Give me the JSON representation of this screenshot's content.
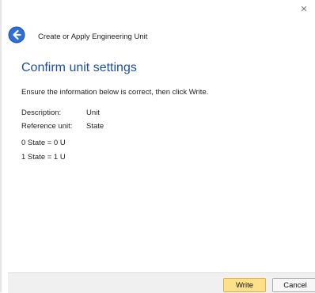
{
  "window": {
    "close_glyph": "×"
  },
  "header": {
    "wizard_title": "Create or Apply Engineering Unit",
    "back_icon": "back-arrow-icon"
  },
  "content": {
    "heading": "Confirm unit settings",
    "instruction": "Ensure the information below is correct, then click Write.",
    "fields": [
      {
        "label": "Description:",
        "value": "Unit"
      },
      {
        "label": "Reference unit:",
        "value": "State"
      }
    ],
    "states": [
      "0 State = 0 U",
      "1 State = 1 U"
    ]
  },
  "footer": {
    "write_label": "Write",
    "cancel_label": "Cancel"
  },
  "colors": {
    "heading": "#1f4e9c",
    "back_icon": "#2f6fd6",
    "write_button": "#fde08a"
  }
}
